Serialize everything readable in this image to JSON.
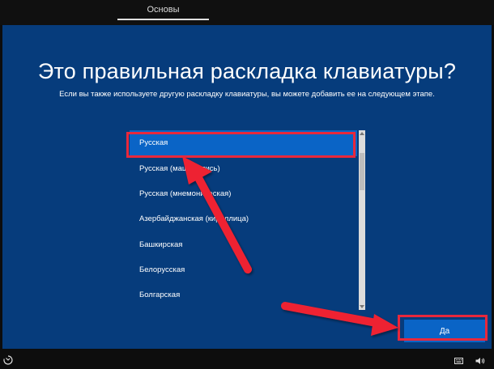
{
  "header": {
    "tab_label": "Основы"
  },
  "main": {
    "title": "Это правильная раскладка клавиатуры?",
    "subtitle": "Если вы также используете другую раскладку клавиатуры, вы можете добавить ее на следующем этапе."
  },
  "layouts": {
    "items": [
      "Русская",
      "Русская (машинопись)",
      "Русская (мнемоническая)",
      "Азербайджанская (кириллица)",
      "Башкирская",
      "Белорусская",
      "Болгарская"
    ],
    "selected_index": 0
  },
  "actions": {
    "yes_label": "Да"
  },
  "icons": {
    "accessibility": "ease-of-access-icon",
    "keyboard": "keyboard-icon",
    "volume": "volume-icon"
  },
  "colors": {
    "background": "#063c7c",
    "accent": "#0a64c6",
    "annotation": "#e8283c"
  }
}
